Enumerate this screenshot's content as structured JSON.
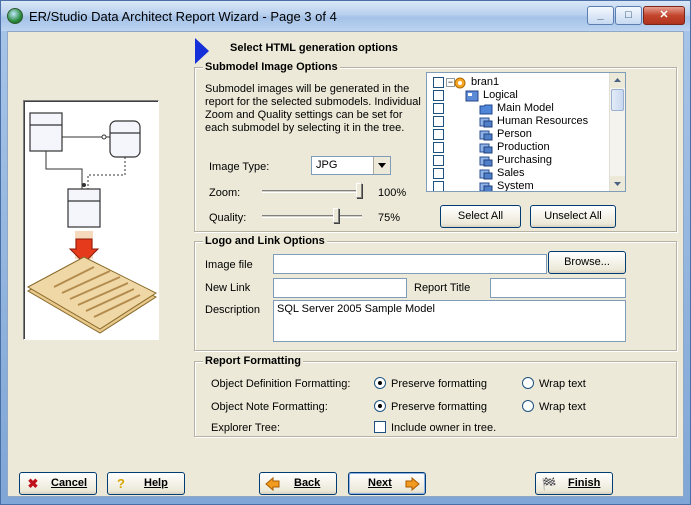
{
  "window": {
    "title": "ER/Studio Data Architect Report Wizard - Page 3 of 4",
    "controls": {
      "minimize": "_",
      "maximize": "□",
      "close": "✕"
    }
  },
  "header": {
    "title": "Select HTML generation options"
  },
  "submodel_image_options": {
    "legend": "Submodel Image Options",
    "description": "Submodel images will be generated in the report for the selected submodels. Individual Zoom and Quality settings can be set for each submodel by selecting it in the tree.",
    "image_type_label": "Image Type:",
    "image_type_value": "JPG",
    "zoom_label": "Zoom:",
    "zoom_value": "100%",
    "zoom_level": 1.0,
    "quality_label": "Quality:",
    "quality_value": "75%",
    "quality_level": 0.75,
    "tree": [
      {
        "label": "bran1",
        "level": 0,
        "icon": "model-icon"
      },
      {
        "label": "Logical",
        "level": 1,
        "icon": "logical-model-icon"
      },
      {
        "label": "Main Model",
        "level": 2,
        "icon": "folder-icon"
      },
      {
        "label": "Human Resources",
        "level": 2,
        "icon": "submodel-icon"
      },
      {
        "label": "Person",
        "level": 2,
        "icon": "submodel-icon"
      },
      {
        "label": "Production",
        "level": 2,
        "icon": "submodel-icon"
      },
      {
        "label": "Purchasing",
        "level": 2,
        "icon": "submodel-icon"
      },
      {
        "label": "Sales",
        "level": 2,
        "icon": "submodel-icon"
      },
      {
        "label": "System",
        "level": 2,
        "icon": "submodel-icon"
      }
    ],
    "select_all": "Select All",
    "unselect_all": "Unselect All"
  },
  "logo_link_options": {
    "legend": "Logo and Link Options",
    "image_file_label": "Image file",
    "image_file_value": "",
    "browse": "Browse...",
    "new_link_label": "New Link",
    "new_link_value": "",
    "report_title_label": "Report Title",
    "report_title_value": "",
    "description_label": "Description",
    "description_value": "SQL Server 2005 Sample Model"
  },
  "report_formatting": {
    "legend": "Report Formatting",
    "object_definition_label": "Object Definition Formatting:",
    "object_note_label": "Object Note Formatting:",
    "preserve_label": "Preserve formatting",
    "wrap_label": "Wrap text",
    "object_definition_choice": "Preserve formatting",
    "object_note_choice": "Preserve formatting",
    "explorer_tree_label": "Explorer Tree:",
    "include_owner_label": "Include owner in tree.",
    "include_owner_checked": false
  },
  "footer": {
    "cancel": "Cancel",
    "help": "Help",
    "back": "Back",
    "next": "Next",
    "finish": "Finish"
  }
}
